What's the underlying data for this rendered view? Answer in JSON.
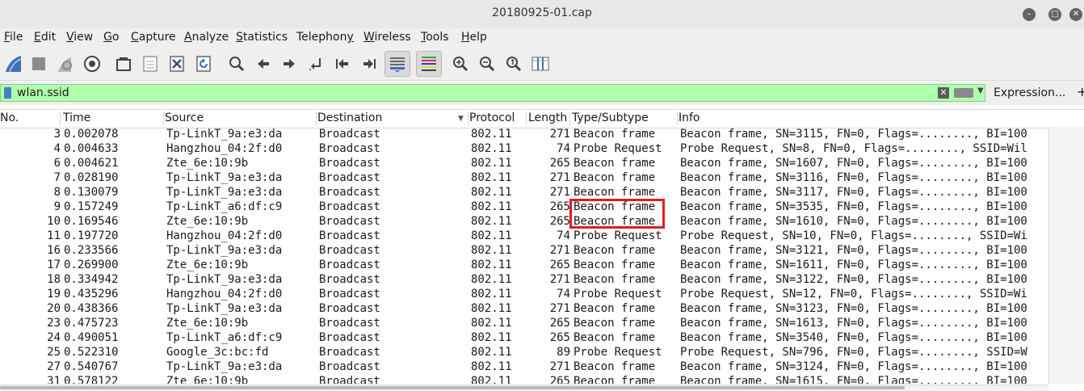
{
  "window": {
    "title": "20180925-01.cap"
  },
  "menu": [
    {
      "pre": "",
      "u": "F",
      "post": "ile"
    },
    {
      "pre": "",
      "u": "E",
      "post": "dit"
    },
    {
      "pre": "",
      "u": "V",
      "post": "iew"
    },
    {
      "pre": "",
      "u": "G",
      "post": "o"
    },
    {
      "pre": "",
      "u": "C",
      "post": "apture"
    },
    {
      "pre": "",
      "u": "A",
      "post": "nalyze"
    },
    {
      "pre": "",
      "u": "S",
      "post": "tatistics"
    },
    {
      "pre": "Telephon",
      "u": "y",
      "post": ""
    },
    {
      "pre": "",
      "u": "W",
      "post": "ireless"
    },
    {
      "pre": "",
      "u": "T",
      "post": "ools"
    },
    {
      "pre": "",
      "u": "H",
      "post": "elp"
    }
  ],
  "filter": {
    "value": "wlan.ssid",
    "expression_label": "Expression...",
    "plus_label": "+"
  },
  "columns": [
    "No.",
    "Time",
    "Source",
    "Destination",
    "Protocol",
    "Length",
    "Type/Subtype",
    "Info"
  ],
  "packets": [
    [
      "3",
      "0.002078",
      "Tp-LinkT_9a:e3:da",
      "Broadcast",
      "802.11",
      "271",
      "Beacon frame",
      "Beacon frame, SN=3115, FN=0, Flags=........, BI=100"
    ],
    [
      "4",
      "0.004633",
      "Hangzhou_04:2f:d0",
      "Broadcast",
      "802.11",
      "74",
      "Probe Request",
      "Probe Request, SN=8, FN=0, Flags=........, SSID=Wil"
    ],
    [
      "6",
      "0.004621",
      "Zte_6e:10:9b",
      "Broadcast",
      "802.11",
      "265",
      "Beacon frame",
      "Beacon frame, SN=1607, FN=0, Flags=........, BI=100"
    ],
    [
      "7",
      "0.028190",
      "Tp-LinkT_9a:e3:da",
      "Broadcast",
      "802.11",
      "271",
      "Beacon frame",
      "Beacon frame, SN=3116, FN=0, Flags=........, BI=100"
    ],
    [
      "8",
      "0.130079",
      "Tp-LinkT_9a:e3:da",
      "Broadcast",
      "802.11",
      "271",
      "Beacon frame",
      "Beacon frame, SN=3117, FN=0, Flags=........, BI=100"
    ],
    [
      "9",
      "0.157249",
      "Tp-LinkT_a6:df:c9",
      "Broadcast",
      "802.11",
      "265",
      "Beacon frame",
      "Beacon frame, SN=3535, FN=0, Flags=........, BI=100"
    ],
    [
      "10",
      "0.169546",
      "Zte_6e:10:9b",
      "Broadcast",
      "802.11",
      "265",
      "Beacon frame",
      "Beacon frame, SN=1610, FN=0, Flags=........, BI=100"
    ],
    [
      "11",
      "0.197720",
      "Hangzhou_04:2f:d0",
      "Broadcast",
      "802.11",
      "74",
      "Probe Request",
      "Probe Request, SN=10, FN=0, Flags=........, SSID=Wi"
    ],
    [
      "16",
      "0.233566",
      "Tp-LinkT_9a:e3:da",
      "Broadcast",
      "802.11",
      "271",
      "Beacon frame",
      "Beacon frame, SN=3121, FN=0, Flags=........, BI=100"
    ],
    [
      "17",
      "0.269900",
      "Zte_6e:10:9b",
      "Broadcast",
      "802.11",
      "265",
      "Beacon frame",
      "Beacon frame, SN=1611, FN=0, Flags=........, BI=100"
    ],
    [
      "18",
      "0.334942",
      "Tp-LinkT_9a:e3:da",
      "Broadcast",
      "802.11",
      "271",
      "Beacon frame",
      "Beacon frame, SN=3122, FN=0, Flags=........, BI=100"
    ],
    [
      "19",
      "0.435296",
      "Hangzhou_04:2f:d0",
      "Broadcast",
      "802.11",
      "74",
      "Probe Request",
      "Probe Request, SN=12, FN=0, Flags=........, SSID=Wi"
    ],
    [
      "20",
      "0.438366",
      "Tp-LinkT_9a:e3:da",
      "Broadcast",
      "802.11",
      "271",
      "Beacon frame",
      "Beacon frame, SN=3123, FN=0, Flags=........, BI=100"
    ],
    [
      "23",
      "0.475723",
      "Zte_6e:10:9b",
      "Broadcast",
      "802.11",
      "265",
      "Beacon frame",
      "Beacon frame, SN=1613, FN=0, Flags=........, BI=100"
    ],
    [
      "24",
      "0.490051",
      "Tp-LinkT_a6:df:c9",
      "Broadcast",
      "802.11",
      "265",
      "Beacon frame",
      "Beacon frame, SN=3540, FN=0, Flags=........, BI=100"
    ],
    [
      "25",
      "0.522310",
      "Google_3c:bc:fd",
      "Broadcast",
      "802.11",
      "89",
      "Probe Request",
      "Probe Request, SN=796, FN=0, Flags=........, SSID=W"
    ],
    [
      "27",
      "0.540767",
      "Tp-LinkT_9a:e3:da",
      "Broadcast",
      "802.11",
      "271",
      "Beacon frame",
      "Beacon frame, SN=3124, FN=0, Flags=........, BI=100"
    ],
    [
      "31",
      "0.578122",
      "Zte_6e:10:9b",
      "Broadcast",
      "802.11",
      "265",
      "Beacon frame",
      "Beacon frame, SN=1615, FN=0, Flags=........, BI=100"
    ]
  ],
  "annotation": {
    "color": "#e01b24",
    "highlighted_rows": [
      "9",
      "10"
    ],
    "column": "Type/Subtype"
  },
  "colors": {
    "filter_bg": "#afffaf",
    "chrome_bg": "#efefee"
  }
}
